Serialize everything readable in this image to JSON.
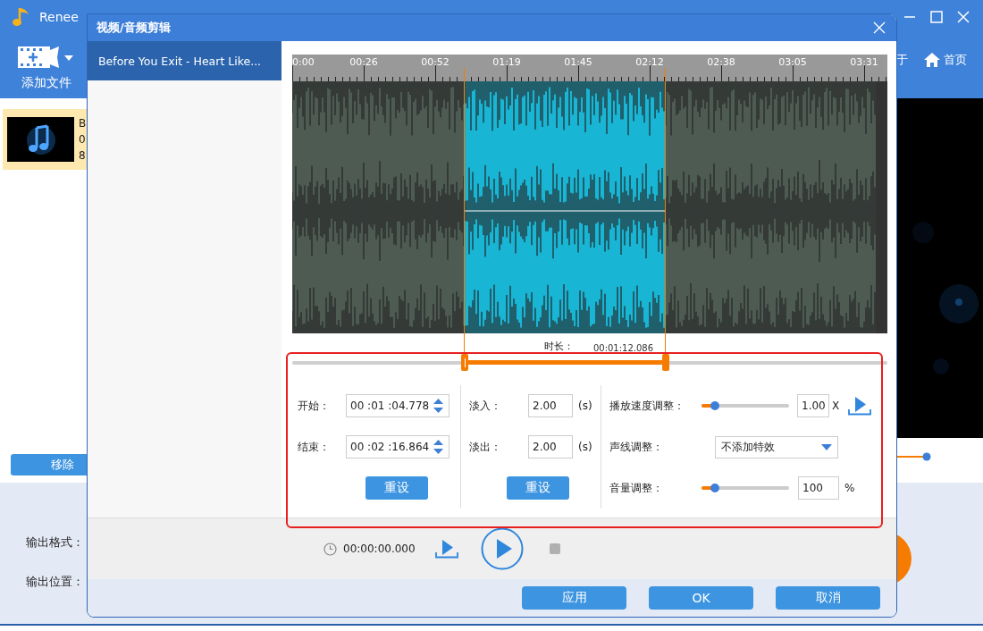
{
  "app": {
    "title": "Renee",
    "preview_slider": {
      "level": 0.85
    },
    "toolbar": {
      "add_file": "添加文件",
      "about_partial": "于",
      "home": "首页"
    },
    "file_list": [
      {
        "lines": [
          "B",
          "0",
          "8"
        ],
        "selected": true
      }
    ],
    "remove_button": "移除",
    "output_format_label": "输出格式：",
    "output_location_label": "输出位置："
  },
  "dialog": {
    "title": "视频/音频剪辑",
    "files": [
      {
        "name": "Before You Exit - Heart Like...",
        "selected": true
      }
    ],
    "ruler_labels": [
      "0:00",
      "00:26",
      "00:52",
      "01:19",
      "01:45",
      "02:12",
      "02:38",
      "03:05",
      "03:31"
    ],
    "trim": [
      {
        "level": 0.29
      },
      {
        "level": 0.627
      }
    ],
    "duration_label": "时长：",
    "duration": "00:01:12.086",
    "start": {
      "label": "开始：",
      "value": "00 :01 :04.778"
    },
    "end": {
      "label": "结束：",
      "value": "00 :02 :16.864"
    },
    "reset_time": "重设",
    "fade_in": {
      "label": "淡入：",
      "value": "2.00",
      "unit": "(s)"
    },
    "fade_out": {
      "label": "淡出：",
      "value": "2.00",
      "unit": "(s)"
    },
    "reset_fade": "重设",
    "speed": {
      "label": "播放速度调整：",
      "level": 0.15,
      "value": "1.00",
      "unit": "X"
    },
    "voice": {
      "label": "声线调整：",
      "value": "不添加特效"
    },
    "volume": {
      "label": "音量调整：",
      "level": 0.15,
      "value": "100",
      "unit": "%"
    },
    "playback_time": "00:00:00.000",
    "buttons": [
      "应用",
      "OK",
      "取消"
    ]
  }
}
